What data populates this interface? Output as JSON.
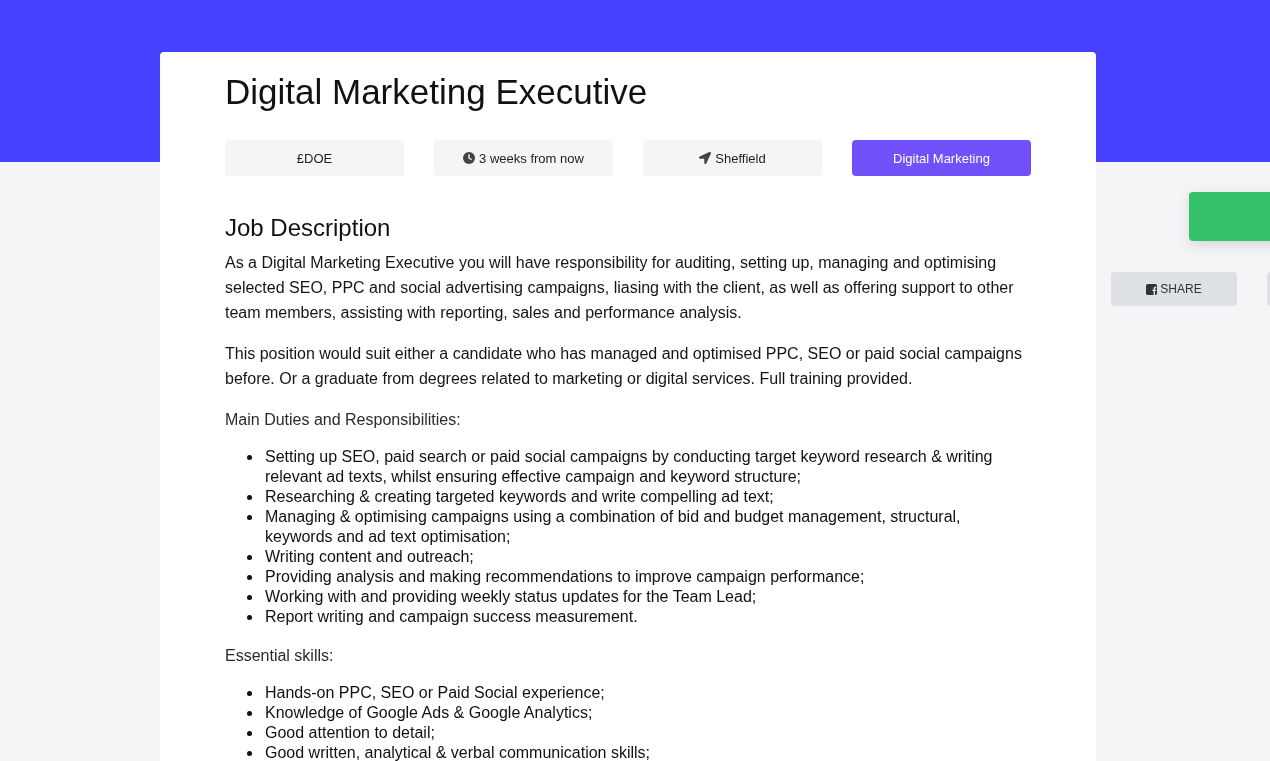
{
  "job": {
    "title": "Digital Marketing Executive",
    "tags": [
      {
        "kind": "salary",
        "label": "£DOE",
        "highlighted": false
      },
      {
        "kind": "deadline",
        "label": "3 weeks from now",
        "highlighted": false
      },
      {
        "kind": "location",
        "label": "Sheffield",
        "highlighted": false
      },
      {
        "kind": "category",
        "label": "Digital Marketing",
        "highlighted": true
      }
    ]
  },
  "description": {
    "heading": "Job Description",
    "paragraphs": [
      "As a Digital Marketing Executive you will have responsibility for auditing, setting up, managing and optimising selected SEO, PPC and social advertising campaigns, liasing with the client, as well as offering support to other team members, assisting with reporting, sales and performance analysis.",
      "This position would suit either a candidate who has managed and optimised PPC, SEO or paid social campaigns before. Or a graduate from degrees related to marketing or digital services. Full training provided."
    ],
    "sections": [
      {
        "heading": "Main Duties and Responsibilities:",
        "items": [
          "Setting up SEO, paid search or paid social campaigns by conducting target keyword research & writing relevant ad texts, whilst ensuring effective campaign and keyword structure;",
          "Researching & creating targeted keywords and write compelling ad text;",
          "Managing & optimising campaigns using a combination of bid and budget management, structural, keywords and ad text optimisation;",
          "Writing content and outreach;",
          "Providing analysis and making recommendations to improve campaign performance;",
          "Working with and providing weekly status updates for the Team Lead;",
          "Report writing and campaign success measurement."
        ]
      },
      {
        "heading": "Essential skills:",
        "items": [
          "Hands-on PPC, SEO or Paid Social experience;",
          "Knowledge of Google Ads & Google Analytics;",
          "Good attention to detail;",
          "Good written, analytical & verbal communication skills;"
        ]
      }
    ]
  },
  "sidebar": {
    "actions": [
      {
        "kind": "apply"
      }
    ],
    "share_buttons": [
      {
        "kind": "facebook",
        "label": "SHARE"
      },
      {
        "kind": "other"
      }
    ]
  }
}
